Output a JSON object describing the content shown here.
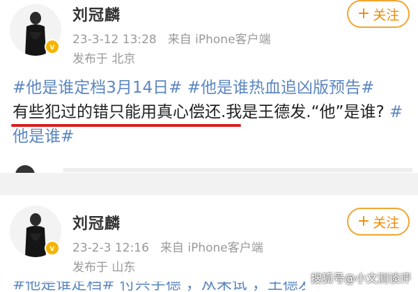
{
  "posts": [
    {
      "author": "刘冠麟",
      "date": "23-3-12 13:28",
      "source": "来自 iPhone客户端",
      "location": "发布于 北京",
      "follow_label": "关注",
      "follow_plus": "+",
      "verified_badge": "v",
      "text": {
        "topic1": "#他是谁定档3月14日#",
        "topic2": "#他是谁热血追凶版预告#",
        "underlined": "有些犯过的错只能用真心偿还",
        "rest": ".我是王德发.“他”是谁?",
        "topic3": "#他是谁#"
      },
      "underline_color": "#d81e1e"
    },
    {
      "author": "刘冠麟",
      "date": "23-2-3 12:16",
      "source": "来自 iPhone客户端",
      "location": "发布于 山东",
      "follow_label": "关注",
      "follow_plus": "+",
      "verified_badge": "v",
      "partial_text": "#他是谁定档# 付兴宇德 ，从未试 ，王德发 #电视"
    }
  ],
  "watermark": "搜狐号@小文测谈评",
  "colors": {
    "topic": "#5c87c0",
    "follow_border": "#f0a530",
    "follow_text": "#f08a00",
    "meta": "#999999",
    "separator": "#f2f2f2",
    "badge": "#f5b400"
  },
  "icons": [
    "avatar-image",
    "verified-badge-icon",
    "plus-icon"
  ]
}
